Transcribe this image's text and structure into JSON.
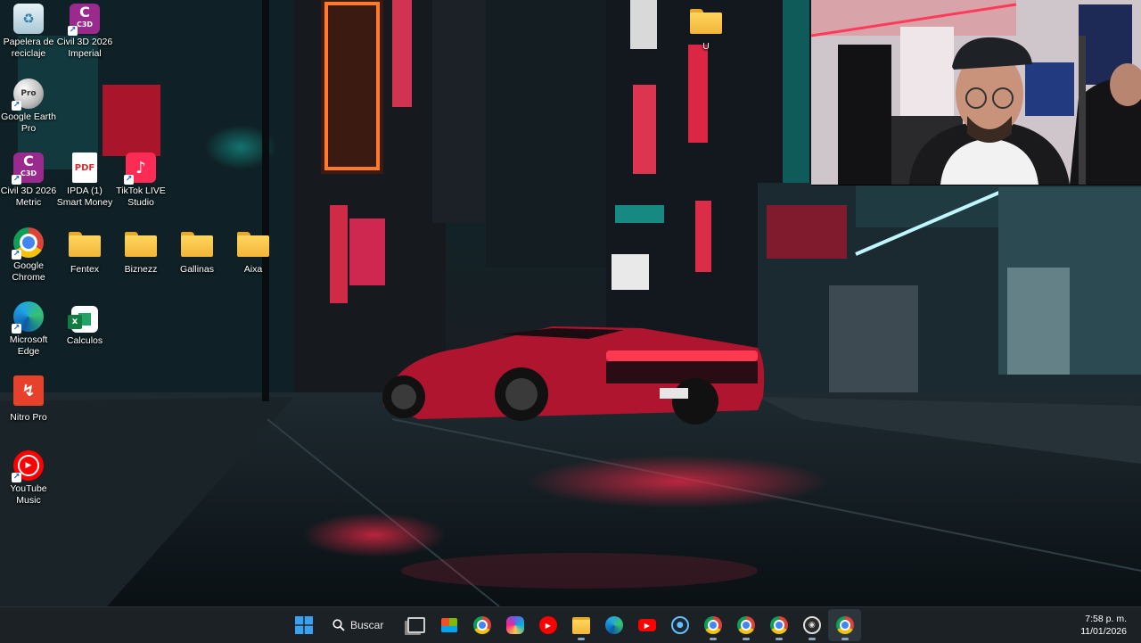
{
  "desktop": {
    "icons": [
      {
        "label": "Papelera de\nreciclaje",
        "icon": "recycle-bin-icon"
      },
      {
        "label": "Civil 3D 2026\nImperial",
        "icon": "civil3d-icon",
        "badge": "C3D"
      },
      {
        "label": "Google Earth\nPro",
        "icon": "google-earth-icon",
        "badge": "Pro"
      },
      {
        "label": "Civil 3D 2026\nMetric",
        "icon": "civil3d-icon",
        "badge": "C3D"
      },
      {
        "label": "IPDA  (1)\nSmart Money",
        "icon": "pdf-icon",
        "badge": "PDF"
      },
      {
        "label": "TikTok LIVE\nStudio",
        "icon": "tiktok-icon"
      },
      {
        "label": "Google\nChrome",
        "icon": "chrome-icon"
      },
      {
        "label": "Fentex",
        "icon": "folder-icon"
      },
      {
        "label": "Biznezz",
        "icon": "folder-icon"
      },
      {
        "label": "Gallinas",
        "icon": "folder-icon"
      },
      {
        "label": "Aixa",
        "icon": "folder-icon"
      },
      {
        "label": "Microsoft\nEdge",
        "icon": "edge-icon"
      },
      {
        "label": "Calculos",
        "icon": "excel-icon"
      },
      {
        "label": "Nitro Pro",
        "icon": "nitro-icon"
      },
      {
        "label": "YouTube\nMusic",
        "icon": "youtube-music-icon"
      },
      {
        "label": "U",
        "icon": "folder-icon"
      }
    ]
  },
  "taskbar": {
    "search_label": "Buscar",
    "time": "7:58 p. m.",
    "date": "11/01/2026",
    "apps": [
      "task-view",
      "store",
      "chrome",
      "copilot",
      "youtube-music",
      "file-explorer",
      "edge",
      "youtube",
      "steam",
      "chrome-profile-1",
      "chrome-profile-2",
      "chrome-profile-3",
      "obs",
      "chrome-profile-4"
    ]
  },
  "colors": {
    "taskbar": "#1c2126",
    "neon_red": "#ff2a4a",
    "neon_teal": "#19d6c8",
    "folder": "#f2b53a"
  }
}
